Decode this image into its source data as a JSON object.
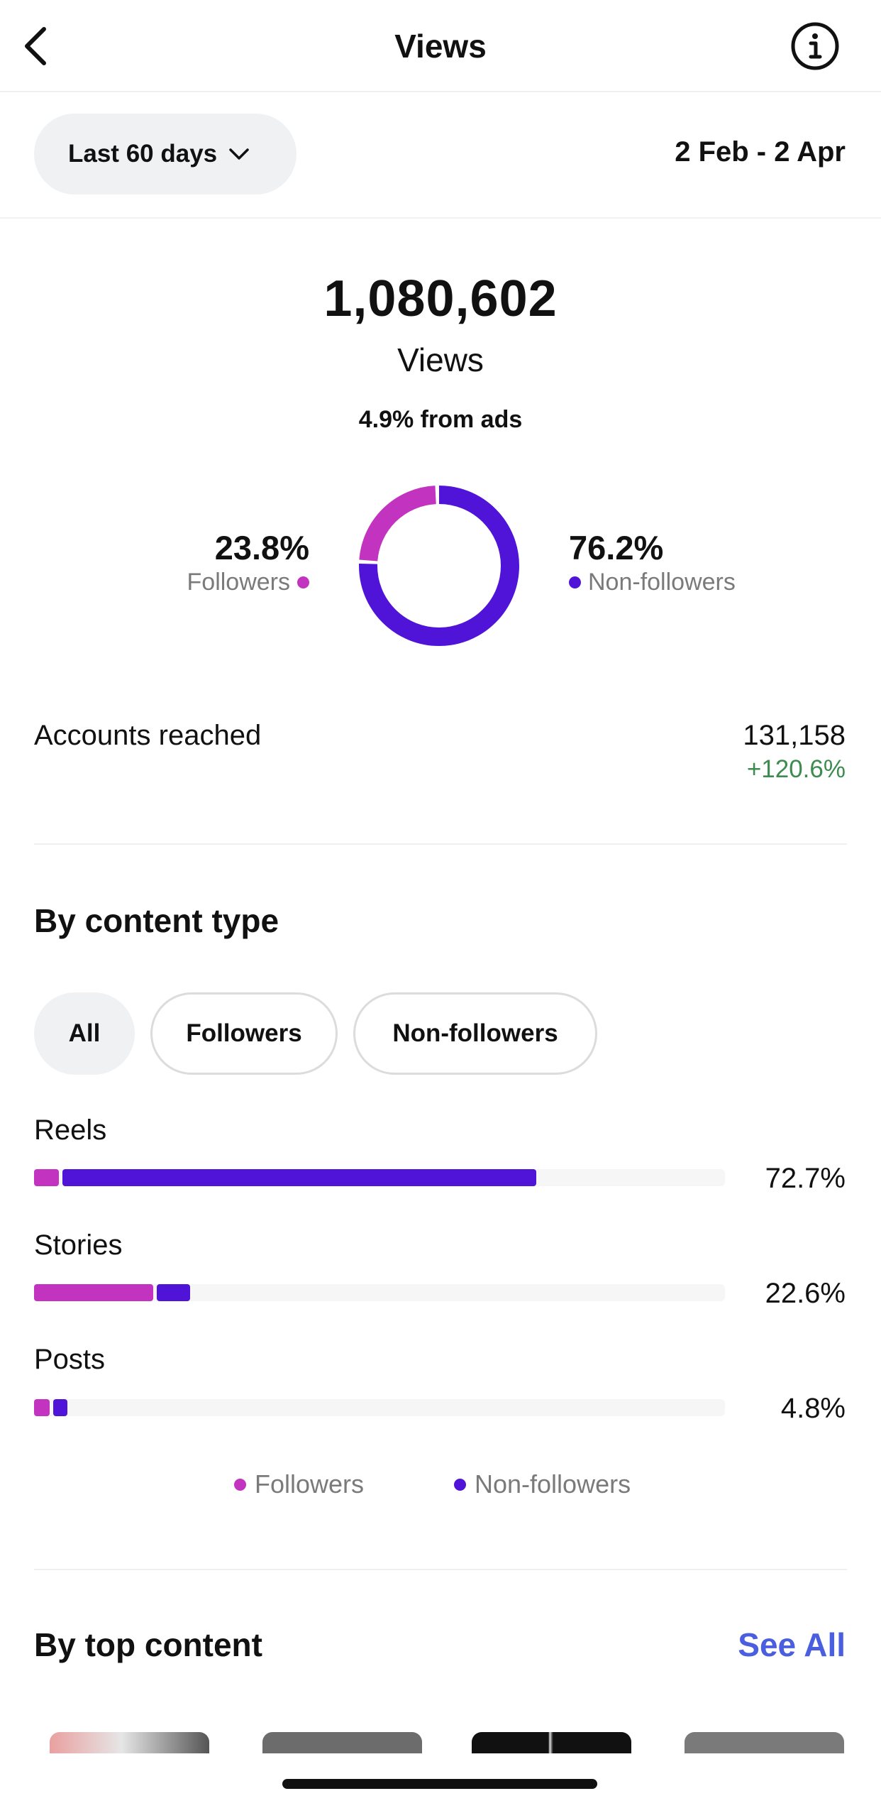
{
  "header": {
    "title": "Views",
    "back_icon": "chevron-left-icon",
    "info_icon": "info-icon"
  },
  "filter": {
    "range_label": "Last 60 days",
    "date_range": "2 Feb - 2 Apr"
  },
  "summary": {
    "total": "1,080,602",
    "total_label": "Views",
    "ads_note": "4.9% from ads",
    "followers_pct": "23.8%",
    "followers_label": "Followers",
    "nonfollowers_pct": "76.2%",
    "nonfollowers_label": "Non-followers",
    "followers_share": 0.238,
    "nonfollowers_share": 0.762
  },
  "accounts": {
    "label": "Accounts reached",
    "value": "131,158",
    "change": "+120.6%"
  },
  "content_type": {
    "title": "By content type",
    "chips": [
      "All",
      "Followers",
      "Non-followers"
    ],
    "rows": [
      {
        "label": "Reels",
        "pct": "72.7%",
        "followers_share": 0.041,
        "nonfollowers_share": 0.686
      },
      {
        "label": "Stories",
        "pct": "22.6%",
        "followers_share": 0.178,
        "nonfollowers_share": 0.048
      },
      {
        "label": "Posts",
        "pct": "4.8%",
        "followers_share": 0.028,
        "nonfollowers_share": 0.02
      }
    ],
    "legend": [
      "Followers",
      "Non-followers"
    ]
  },
  "top_content": {
    "title": "By top content",
    "see_all": "See All"
  },
  "colors": {
    "followers": "#c233c0",
    "nonfollowers": "#5014d8",
    "positive": "#3d8b4f",
    "link": "#4a5ee0"
  }
}
